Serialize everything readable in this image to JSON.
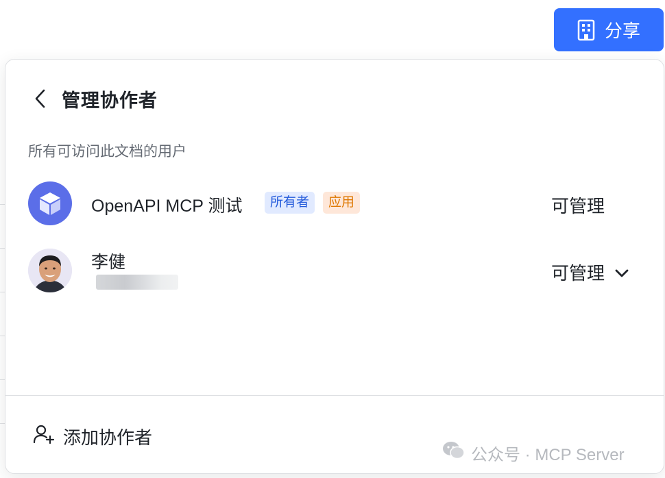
{
  "share_button": {
    "label": "分享",
    "icon": "building-icon",
    "color": "#3370ff"
  },
  "panel": {
    "title": "管理协作者",
    "back_icon": "chevron-left-icon",
    "section_label": "所有可访问此文档的用户",
    "members": [
      {
        "name": "OpenAPI MCP 测试",
        "avatar": "cube-icon",
        "badges": [
          "所有者",
          "应用"
        ],
        "permission": "可管理"
      },
      {
        "name": "李健",
        "avatar": "user-photo",
        "email": "blurred",
        "permission": "可管理",
        "permission_icon": "chevron-down-icon"
      }
    ],
    "add_collaborator": {
      "label": "添加协作者",
      "icon": "user-plus-icon"
    }
  },
  "watermark": {
    "text": "公众号 · MCP Server",
    "icon": "wechat-icon"
  },
  "colors": {
    "accent": "#3370ff",
    "owner_badge": "#245bdb",
    "app_badge": "#de7802"
  }
}
